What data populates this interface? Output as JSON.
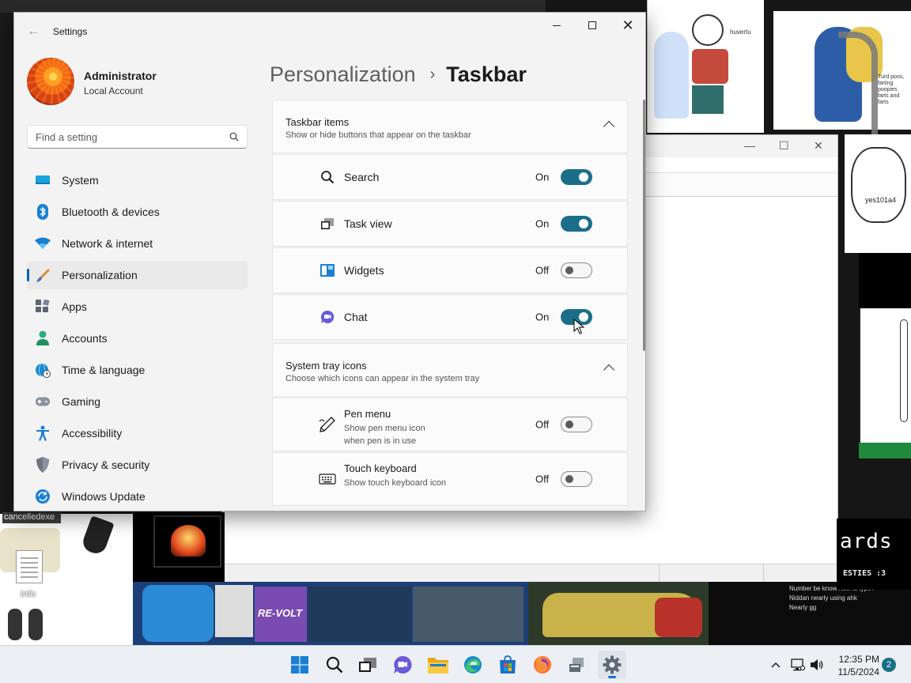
{
  "desktop": {
    "icon_label_cancelled": "cancelledexe",
    "icon_label_info": "info",
    "background_texts": {
      "comic_caption": "huvertu",
      "cat_note": "Turd poos, farting poopies farts and farts",
      "sketch_name": "yes101a4",
      "ards_big": "ards",
      "ards_small": "ESTIES :3",
      "chat_line1": "Number be know how to type?",
      "chat_line2": "Niddan nearly using ahk",
      "chat_line3": "Nearly gg",
      "revolt_title": "RE-VOLT"
    }
  },
  "window": {
    "title": "Settings",
    "back_label": "←",
    "min_label": "Minimize",
    "max_label": "Maximize",
    "close_label": "✕"
  },
  "profile": {
    "name": "Administrator",
    "account_type": "Local Account"
  },
  "search": {
    "placeholder": "Find a setting",
    "value": ""
  },
  "nav": {
    "items": [
      {
        "label": "System",
        "icon": "monitor-icon"
      },
      {
        "label": "Bluetooth & devices",
        "icon": "bluetooth-icon"
      },
      {
        "label": "Network & internet",
        "icon": "wifi-icon"
      },
      {
        "label": "Personalization",
        "icon": "paintbrush-icon",
        "active": true
      },
      {
        "label": "Apps",
        "icon": "apps-icon"
      },
      {
        "label": "Accounts",
        "icon": "person-icon"
      },
      {
        "label": "Time & language",
        "icon": "globe-clock-icon"
      },
      {
        "label": "Gaming",
        "icon": "gamepad-icon"
      },
      {
        "label": "Accessibility",
        "icon": "accessibility-icon"
      },
      {
        "label": "Privacy & security",
        "icon": "shield-icon"
      },
      {
        "label": "Windows Update",
        "icon": "update-icon"
      }
    ]
  },
  "breadcrumb": {
    "parent": "Personalization",
    "separator": "›",
    "current": "Taskbar"
  },
  "taskbar_items": {
    "title": "Taskbar items",
    "subtitle": "Show or hide buttons that appear on the taskbar",
    "rows": [
      {
        "label": "Search",
        "state": "On",
        "on": true,
        "icon": "search-icon"
      },
      {
        "label": "Task view",
        "state": "On",
        "on": true,
        "icon": "task-view-icon"
      },
      {
        "label": "Widgets",
        "state": "Off",
        "on": false,
        "icon": "widgets-icon"
      },
      {
        "label": "Chat",
        "state": "On",
        "on": true,
        "icon": "chat-icon"
      }
    ]
  },
  "system_tray": {
    "title": "System tray icons",
    "subtitle": "Choose which icons can appear in the system tray",
    "rows": [
      {
        "label": "Pen menu",
        "desc": "Show pen menu icon when pen is in use",
        "state": "Off",
        "on": false,
        "icon": "pen-icon"
      },
      {
        "label": "Touch keyboard",
        "desc": "Show touch keyboard icon",
        "state": "Off",
        "on": false,
        "icon": "keyboard-icon"
      }
    ]
  },
  "os_taskbar": {
    "time": "12:35 PM",
    "date": "11/5/2024",
    "notification_count": "2",
    "apps": [
      "start",
      "search",
      "task-view",
      "chat",
      "file-explorer",
      "edge",
      "store",
      "firefox",
      "app-installer",
      "settings"
    ]
  },
  "colors": {
    "accent": "#1a6e8a",
    "nav_accent": "#005fb8",
    "window_bg": "#f3f3f3",
    "card_bg": "#fbfbfb"
  }
}
